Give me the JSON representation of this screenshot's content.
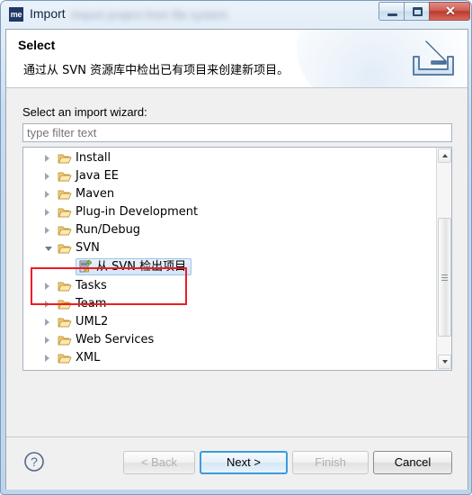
{
  "window": {
    "title": "Import",
    "app_badge": "me",
    "blurred_subtitle": "Import project from file system",
    "controls": {
      "minimize": "minimize-button",
      "maximize": "maximize-button",
      "close_glyph": "✕"
    }
  },
  "header": {
    "title": "Select",
    "description": "通过从 SVN 资源库中检出已有项目来创建新项目。",
    "icon": "import-wizard-icon"
  },
  "filter": {
    "label": "Select an import wizard:",
    "placeholder": "type filter text",
    "value": ""
  },
  "tree": {
    "items": [
      {
        "label": "Install",
        "expanded": false,
        "icon": "folder-icon"
      },
      {
        "label": "Java EE",
        "expanded": false,
        "icon": "folder-icon"
      },
      {
        "label": "Maven",
        "expanded": false,
        "icon": "folder-icon"
      },
      {
        "label": "Plug-in Development",
        "expanded": false,
        "icon": "folder-icon"
      },
      {
        "label": "Run/Debug",
        "expanded": false,
        "icon": "folder-icon"
      },
      {
        "label": "SVN",
        "expanded": true,
        "icon": "folder-icon"
      },
      {
        "label": "Tasks",
        "expanded": false,
        "icon": "folder-icon"
      },
      {
        "label": "Team",
        "expanded": false,
        "icon": "folder-icon"
      },
      {
        "label": "UML2",
        "expanded": false,
        "icon": "folder-icon"
      },
      {
        "label": "Web Services",
        "expanded": false,
        "icon": "folder-icon"
      },
      {
        "label": "XML",
        "expanded": false,
        "icon": "folder-icon"
      }
    ],
    "selected_leaf": {
      "label": "从 SVN 检出项目",
      "icon": "svn-checkout-icon",
      "parent": "SVN"
    },
    "highlight_color": "#ee1c24"
  },
  "scrollbar": {
    "up_arrow": "scroll-up-arrow",
    "down_arrow": "scroll-down-arrow"
  },
  "buttons": {
    "help": "?",
    "back": "< Back",
    "next": "Next >",
    "finish": "Finish",
    "cancel": "Cancel"
  },
  "colors": {
    "accent": "#3c9bde",
    "annotation": "#ee1c24",
    "titlebar": "#c3d9ee",
    "close": "#bb3a2d"
  }
}
